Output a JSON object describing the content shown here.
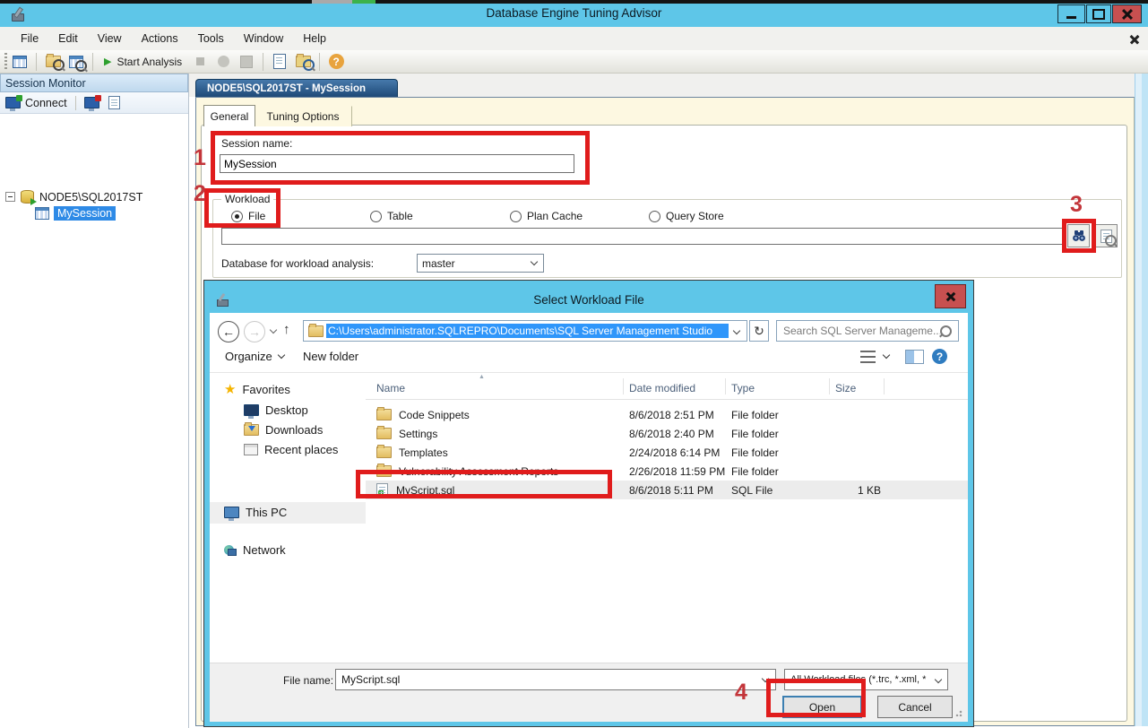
{
  "window": {
    "title": "Database Engine Tuning Advisor"
  },
  "menu": {
    "items": [
      "File",
      "Edit",
      "View",
      "Actions",
      "Tools",
      "Window",
      "Help"
    ]
  },
  "toolbar": {
    "start_analysis": "Start Analysis"
  },
  "session_monitor": {
    "title": "Session Monitor",
    "connect": "Connect",
    "server": "NODE5\\SQL2017ST",
    "session": "MySession"
  },
  "document": {
    "tab_title": "NODE5\\SQL2017ST - MySession",
    "tab_general": "General",
    "tab_tuning": "Tuning Options",
    "session_name_label": "Session name:",
    "session_name_value": "MySession",
    "workload_label": "Workload",
    "radio_file": "File",
    "radio_table": "Table",
    "radio_plan_cache": "Plan Cache",
    "radio_query_store": "Query Store",
    "workload_path_value": "",
    "db_label": "Database for workload analysis:",
    "db_value": "master"
  },
  "dialog": {
    "title": "Select Workload File",
    "address": "C:\\Users\\administrator.SQLREPRO\\Documents\\SQL Server Management Studio",
    "search_placeholder": "Search SQL Server Manageme...",
    "organize": "Organize",
    "new_folder": "New folder",
    "nav": {
      "favorites": "Favorites",
      "desktop": "Desktop",
      "downloads": "Downloads",
      "recent": "Recent places",
      "this_pc": "This PC",
      "network": "Network"
    },
    "columns": {
      "name": "Name",
      "date": "Date modified",
      "type": "Type",
      "size": "Size"
    },
    "rows": [
      {
        "name": "Code Snippets",
        "date": "8/6/2018 2:51 PM",
        "type": "File folder",
        "size": ""
      },
      {
        "name": "Settings",
        "date": "8/6/2018 2:40 PM",
        "type": "File folder",
        "size": ""
      },
      {
        "name": "Templates",
        "date": "2/24/2018 6:14 PM",
        "type": "File folder",
        "size": ""
      },
      {
        "name": "Vulnerability Assessment Reports",
        "date": "2/26/2018 11:59 PM",
        "type": "File folder",
        "size": ""
      },
      {
        "name": "MyScript.sql",
        "date": "8/6/2018 5:11 PM",
        "type": "SQL File",
        "size": "1 KB"
      }
    ],
    "file_name_label": "File name:",
    "file_name_value": "MyScript.sql",
    "filter_value": "All Workload files (*.trc, *.xml, *",
    "open": "Open",
    "cancel": "Cancel"
  },
  "icons": {
    "back_arrow": "←",
    "forward_arrow": "→",
    "up_arrow": "↑",
    "refresh": "↻",
    "sort_asc": "▲",
    "play": "▶",
    "help": "?"
  },
  "annotations": {
    "n1": "1",
    "n2": "2",
    "n3": "3",
    "n4": "4"
  }
}
